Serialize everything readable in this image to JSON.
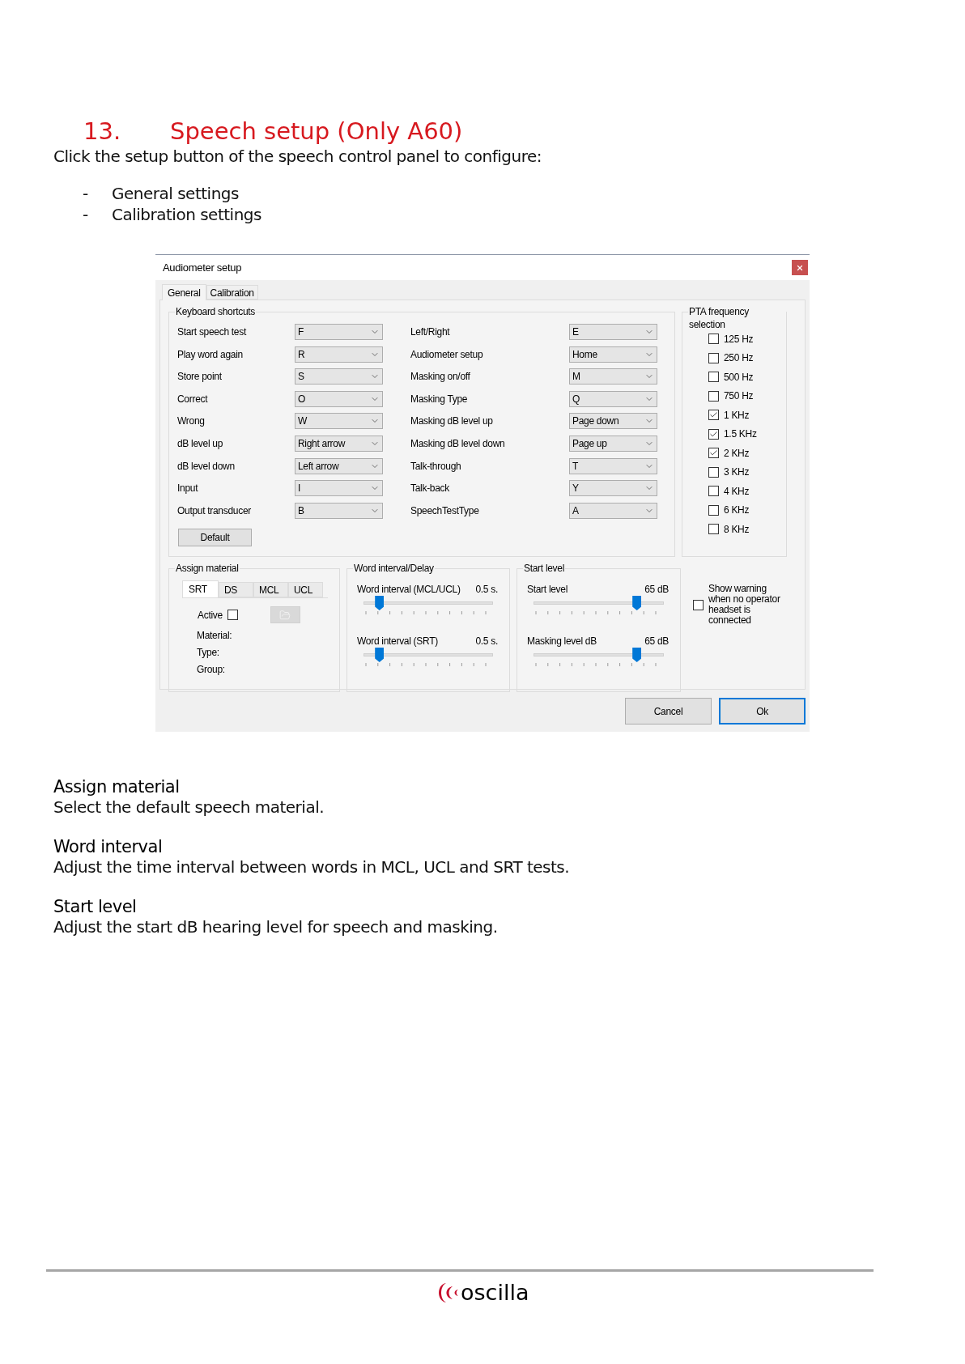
{
  "heading": {
    "number": "13.",
    "title": "Speech setup (Only A60)"
  },
  "intro": "Click the setup button of the speech control panel to configure:",
  "bullets": [
    {
      "marker": "-",
      "text": "General settings"
    },
    {
      "marker": "-",
      "text": "Calibration settings"
    }
  ],
  "dialog": {
    "title": "Audiometer setup",
    "tabs": [
      {
        "label": "General",
        "selected": true
      },
      {
        "label": "Calibration",
        "selected": false
      }
    ],
    "shortcuts": {
      "title": "Keyboard shortcuts",
      "left": [
        {
          "label": "Start speech test",
          "value": "F"
        },
        {
          "label": "Play word again",
          "value": "R"
        },
        {
          "label": "Store point",
          "value": "S"
        },
        {
          "label": "Correct",
          "value": "O"
        },
        {
          "label": "Wrong",
          "value": "W"
        },
        {
          "label": "dB level up",
          "value": "Right arrow"
        },
        {
          "label": "dB level down",
          "value": "Left arrow"
        },
        {
          "label": "Input",
          "value": "I"
        },
        {
          "label": "Output transducer",
          "value": "B"
        }
      ],
      "right": [
        {
          "label": "Left/Right",
          "value": "E"
        },
        {
          "label": "Audiometer setup",
          "value": "Home"
        },
        {
          "label": "Masking on/off",
          "value": "M"
        },
        {
          "label": "Masking Type",
          "value": "Q"
        },
        {
          "label": "Masking dB level up",
          "value": "Page down"
        },
        {
          "label": "Masking dB level down",
          "value": "Page up"
        },
        {
          "label": "Talk-through",
          "value": "T"
        },
        {
          "label": "Talk-back",
          "value": "Y"
        },
        {
          "label": "SpeechTestType",
          "value": "A"
        }
      ],
      "default_button": "Default"
    },
    "pta": {
      "title": "PTA frequency selection",
      "items": [
        {
          "label": "125 Hz",
          "checked": false
        },
        {
          "label": "250 Hz",
          "checked": false
        },
        {
          "label": "500 Hz",
          "checked": false
        },
        {
          "label": "750 Hz",
          "checked": false
        },
        {
          "label": "1 KHz",
          "checked": true
        },
        {
          "label": "1.5 KHz",
          "checked": true
        },
        {
          "label": "2 KHz",
          "checked": true
        },
        {
          "label": "3 KHz",
          "checked": false
        },
        {
          "label": "4 KHz",
          "checked": false
        },
        {
          "label": "6 KHz",
          "checked": false
        },
        {
          "label": "8 KHz",
          "checked": false
        }
      ]
    },
    "assign": {
      "title": "Assign material",
      "tabs": [
        {
          "label": "SRT",
          "selected": true
        },
        {
          "label": "DS",
          "selected": false
        },
        {
          "label": "MCL",
          "selected": false
        },
        {
          "label": "UCL",
          "selected": false
        }
      ],
      "active": {
        "label": "Active",
        "checked": false
      },
      "fields": [
        "Material:",
        "Type:",
        "Group:"
      ]
    },
    "word_interval": {
      "title": "Word interval/Delay",
      "sliders": [
        {
          "label": "Word interval (MCL/UCL)",
          "reading": "0.5 s.",
          "level": 0.12
        },
        {
          "label": "Word interval (SRT)",
          "reading": "0.5 s.",
          "level": 0.12
        }
      ]
    },
    "start_level": {
      "title": "Start level",
      "sliders": [
        {
          "label": "Start level",
          "reading": "65 dB",
          "level": 0.79
        },
        {
          "label": "Masking level dB",
          "reading": "65 dB",
          "level": 0.79
        }
      ]
    },
    "warning": {
      "label": "Show warning when no operator headset is connected",
      "checked": false
    },
    "buttons": [
      {
        "label": "Cancel",
        "kind": "normal"
      },
      {
        "label": "Ok",
        "kind": "default"
      }
    ]
  },
  "sections": [
    {
      "title": "Assign material",
      "text": "Select the default speech material."
    },
    {
      "title": "Word interval",
      "text": "Adjust the time interval between words in MCL, UCL and SRT tests."
    },
    {
      "title": "Start level",
      "text": "Adjust the start dB hearing level for speech and masking."
    }
  ],
  "footer": {
    "logo": "oscilla"
  }
}
